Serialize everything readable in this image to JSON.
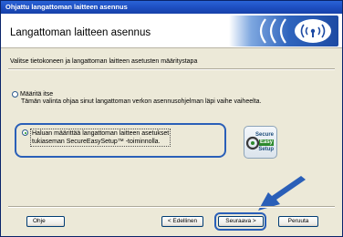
{
  "window": {
    "title": "Ohjattu langattoman laitteen asennus"
  },
  "header": {
    "title": "Langattoman laitteen asennus"
  },
  "instruction": "Valitse tietokoneen ja langattoman laitteen asetusten määritystapa",
  "options": [
    {
      "label": "Määritä itse",
      "description": "Tämän valinta ohjaa sinut langattoman verkon asennusohjelman läpi vaihe vaiheelta.",
      "checked": false
    },
    {
      "label_line1": "Haluan määrittää langattoman laitteen asetukset",
      "label_line2": "tukiaseman SecureEasySetup™ -toiminnolla.",
      "checked": true
    }
  ],
  "badge": {
    "line1": "Secure",
    "line2": "Easy",
    "line3": "Setup"
  },
  "buttons": {
    "help": "Ohje",
    "back": "< Edellinen",
    "next": "Seuraava >",
    "cancel": "Peruuta"
  },
  "colors": {
    "title_bar": "#1e4fc2",
    "highlight": "#2a5fb8",
    "arrow": "#2a5fb8",
    "badge_green": "#2d8a2d"
  },
  "icons": [
    "wireless-signal-icon",
    "secure-easy-setup-icon",
    "pointer-arrow-icon"
  ]
}
